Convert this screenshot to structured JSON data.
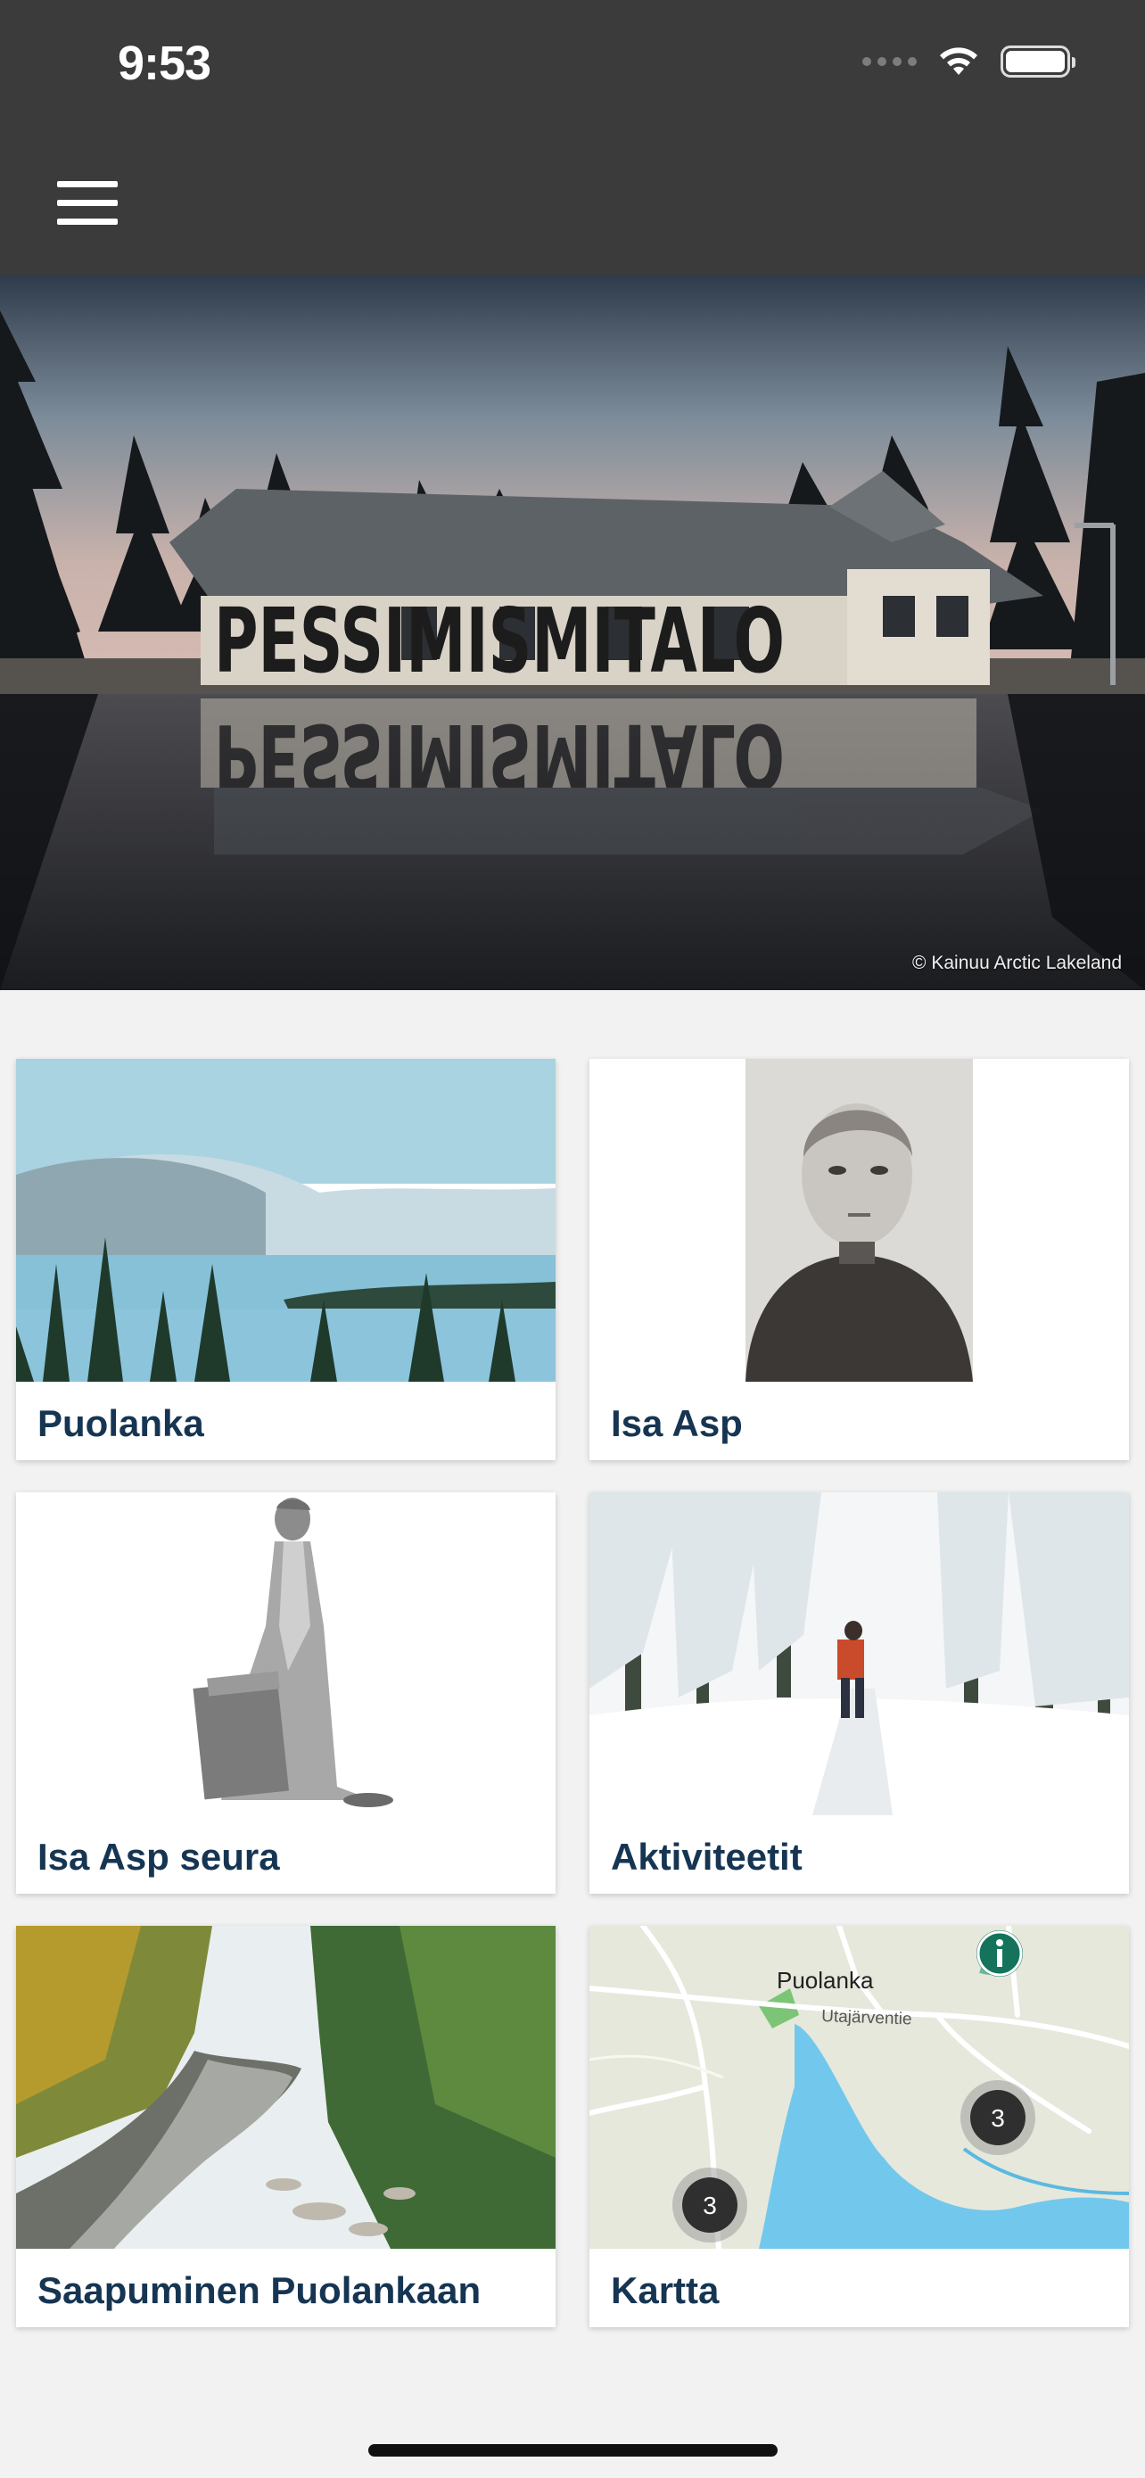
{
  "status_bar": {
    "time": "9:53",
    "icons": [
      "signal-icon",
      "wifi-icon",
      "battery-icon"
    ]
  },
  "header": {
    "menu_icon": "hamburger-menu-icon",
    "background": "#3b3b3b"
  },
  "hero": {
    "sign_text": "PESSIMISMITALO",
    "credit": "© Kainuu Arctic Lakeland"
  },
  "tiles": [
    {
      "label": "Puolanka"
    },
    {
      "label": "Isa Asp"
    },
    {
      "label": "Isa Asp seura"
    },
    {
      "label": "Aktiviteetit"
    },
    {
      "label": "Saapuminen Puolankaan"
    },
    {
      "label": "Kartta"
    }
  ],
  "map": {
    "place_label": "Puolanka",
    "road_label": "Utajärventie",
    "cluster_counts": [
      "3",
      "3"
    ],
    "info_marker_icon": "info-icon"
  },
  "theme": {
    "label_color": "#163552",
    "page_background": "#f2f2f2",
    "map_water": "#72c8ec",
    "map_land": "#e6e8dc"
  }
}
